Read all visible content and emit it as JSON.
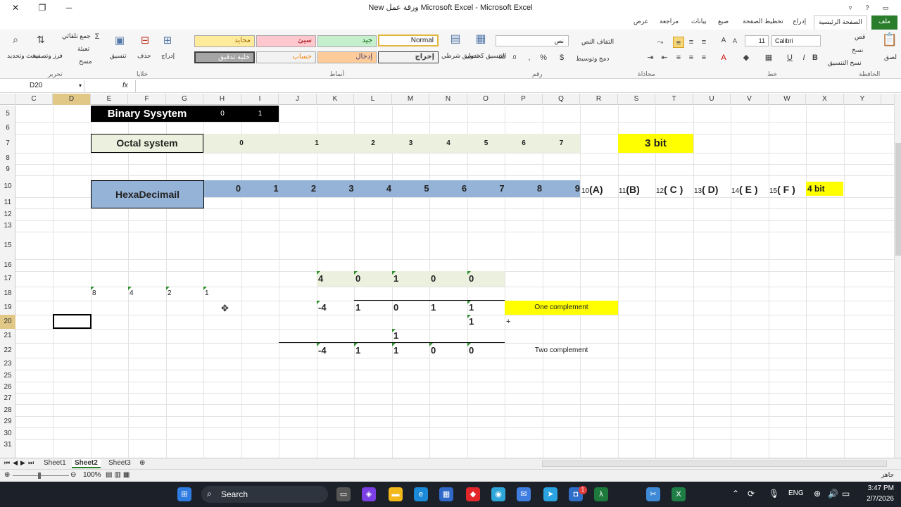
{
  "window": {
    "title": "New ورقة عمل Microsoft Excel - Microsoft Excel"
  },
  "ribbon_tabs": [
    "ملف",
    "الصفحة الرئيسية",
    "إدراج",
    "تخطيط الصفحة",
    "صيغ",
    "بيانات",
    "مراجعة",
    "عرض"
  ],
  "ribbon": {
    "clipboard": {
      "group": "الحافظة",
      "paste": "لصق",
      "cut": "قص",
      "copy": "نسخ",
      "format_painter": "نسخ التنسيق"
    },
    "font": {
      "group": "خط",
      "name": "Calibri",
      "size": "11"
    },
    "alignment": {
      "group": "محاذاة",
      "wrap": "التفاف النص",
      "merge": "دمج وتوسيط"
    },
    "number": {
      "group": "رقم",
      "format": "نص"
    },
    "styles": {
      "group": "أنماط",
      "conditional": "تنسيق شرطي",
      "as_table": "التنسيق كجدول",
      "normal": "Normal",
      "good": "جيد",
      "bad": "سيئ",
      "neutral": "محايد",
      "output": "إخراج",
      "input": "إدخال",
      "calculation": "حساب",
      "check_cell": "خلية تدقيق"
    },
    "cells": {
      "group": "خلايا",
      "insert": "إدراج",
      "delete": "حذف",
      "format": "تنسيق"
    },
    "editing": {
      "group": "تحرير",
      "autosum": "جمع تلقائي",
      "fill": "تعبئة",
      "clear": "مسح",
      "sort": "فرز وتصفية",
      "find": "بحث وتحديد"
    }
  },
  "formula_bar": {
    "name_box": "D20",
    "fx": "fx",
    "formula": ""
  },
  "columns": [
    "C",
    "D",
    "E",
    "F",
    "G",
    "H",
    "I",
    "J",
    "K",
    "L",
    "M",
    "N",
    "O",
    "P",
    "Q",
    "R",
    "S",
    "T",
    "U",
    "V",
    "W",
    "X",
    "Y"
  ],
  "rows": [
    "5",
    "6",
    "7",
    "8",
    "9",
    "10",
    "11",
    "12",
    "13",
    "15",
    "16",
    "17",
    "18",
    "19",
    "20",
    "21",
    "22",
    "23",
    "25",
    "26",
    "27",
    "28",
    "29",
    "30",
    "31"
  ],
  "selected": {
    "column": "D",
    "row": "20"
  },
  "content": {
    "binary_title": "Binary Sysytem",
    "binary_values": [
      "0",
      "1"
    ],
    "octal_title": "Octal system",
    "octal_values": [
      "0",
      "1",
      "2",
      "3",
      "4",
      "5",
      "6",
      "7"
    ],
    "octal_bit": "3 bit",
    "hex_title": "HexaDecimail",
    "hex_values": [
      "0",
      "1",
      "2",
      "3",
      "4",
      "5",
      "6",
      "7",
      "8",
      "9"
    ],
    "hex_letters": [
      {
        "num": "10",
        "letter": "(A)"
      },
      {
        "num": "11",
        "letter": "(B)"
      },
      {
        "num": "12",
        "letter": "( C )"
      },
      {
        "num": "13",
        "letter": "( D)"
      },
      {
        "num": "14",
        "letter": "( E )"
      },
      {
        "num": "15",
        "letter": "( F )"
      }
    ],
    "hex_bit": "4 bit",
    "row17": [
      "4",
      "0",
      "1",
      "0",
      "0"
    ],
    "row18_weights": [
      "8",
      "4",
      "2",
      "1"
    ],
    "row19": [
      "-4",
      "1",
      "0",
      "1",
      "1"
    ],
    "one_complement": "One complement",
    "row20": "1",
    "plus": "+",
    "row21": "1",
    "row22": [
      "-4",
      "1",
      "1",
      "0",
      "0"
    ],
    "two_complement": "Two complement"
  },
  "sheets": [
    "Sheet1",
    "Sheet2",
    "Sheet3"
  ],
  "active_sheet": "Sheet2",
  "status": {
    "ready": "جاهز",
    "zoom": "100%"
  },
  "taskbar": {
    "search": "Search",
    "lang": "ENG",
    "time": "3:47 PM",
    "date": "2/7/2026",
    "notification_badge": "1"
  },
  "colors": {
    "excel_green": "#2a7d2a",
    "yellow": "#ffff00",
    "hex_blue": "#95b3d7",
    "octal_green": "#ebf1de",
    "row17_green": "#ebf1de"
  }
}
